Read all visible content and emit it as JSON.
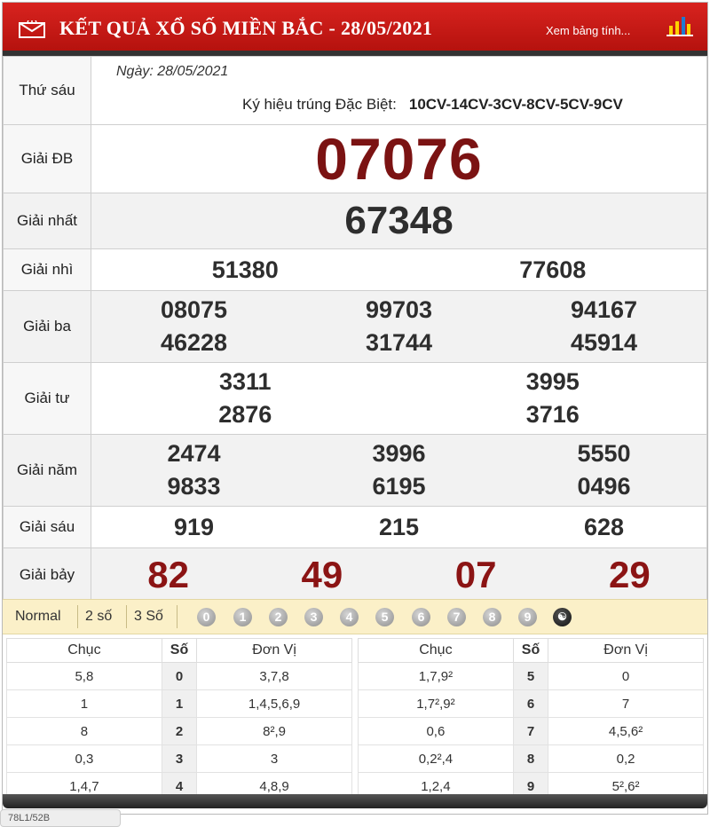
{
  "header": {
    "title": "KẾT QUẢ XỔ SỐ MIỀN BẮC - 28/05/2021",
    "view_link": "Xem bảng tính...",
    "mail_icon": "envelope-icon",
    "chart_icon": "bar-chart-icon"
  },
  "info": {
    "day": "Thứ sáu",
    "date": "Ngày: 28/05/2021",
    "symbol_label": "Ký hiệu trúng Đặc Biệt:",
    "symbol_value": "10CV-14CV-3CV-8CV-5CV-9CV"
  },
  "prizes": {
    "db": {
      "label": "Giải ĐB",
      "value": "07076"
    },
    "g1": {
      "label": "Giải nhất",
      "value": "67348"
    },
    "g2": {
      "label": "Giải nhì",
      "values": [
        "51380",
        "77608"
      ]
    },
    "g3": {
      "label": "Giải ba",
      "values": [
        "08075",
        "99703",
        "94167",
        "46228",
        "31744",
        "45914"
      ]
    },
    "g4": {
      "label": "Giải tư",
      "values": [
        "3311",
        "3995",
        "2876",
        "3716"
      ]
    },
    "g5": {
      "label": "Giải năm",
      "values": [
        "2474",
        "3996",
        "5550",
        "9833",
        "6195",
        "0496"
      ]
    },
    "g6": {
      "label": "Giải sáu",
      "values": [
        "919",
        "215",
        "628"
      ]
    },
    "g7": {
      "label": "Giải bảy",
      "values": [
        "82",
        "49",
        "07",
        "29"
      ]
    }
  },
  "filters": {
    "options": [
      "Normal",
      "2 số",
      "3 Số"
    ],
    "balls": [
      "0",
      "1",
      "2",
      "3",
      "4",
      "5",
      "6",
      "7",
      "8",
      "9"
    ],
    "all_icon": "yin-yang-icon"
  },
  "loto": {
    "headers": {
      "chuc": "Chục",
      "so": "Số",
      "donvi": "Đơn Vị"
    },
    "left": [
      {
        "chuc": "5,8",
        "so": "0",
        "donvi": "3,7,8"
      },
      {
        "chuc": "1",
        "so": "1",
        "donvi": "1,4,5,6,9"
      },
      {
        "chuc": "8",
        "so": "2",
        "donvi": "8²,9"
      },
      {
        "chuc": "0,3",
        "so": "3",
        "donvi": "3"
      },
      {
        "chuc": "1,4,7",
        "so": "4",
        "donvi": "4,8,9"
      }
    ],
    "right": [
      {
        "chuc": "1,7,9²",
        "so": "5",
        "donvi": "0"
      },
      {
        "chuc": "1,7²,9²",
        "so": "6",
        "donvi": "7"
      },
      {
        "chuc": "0,6",
        "so": "7",
        "donvi": "4,5,6²"
      },
      {
        "chuc": "0,2²,4",
        "so": "8",
        "donvi": "0,2"
      },
      {
        "chuc": "1,2,4",
        "so": "9",
        "donvi": "5²,6²"
      }
    ]
  },
  "footer_tab": "78L1/52B"
}
